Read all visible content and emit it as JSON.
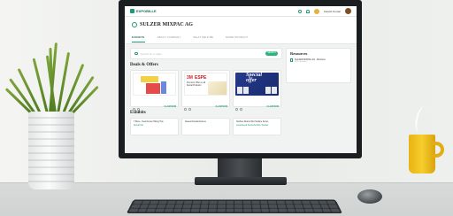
{
  "app": {
    "brand": "EXPOBILLE",
    "user_name": "Suresh Kumar"
  },
  "company": {
    "name": "SULZER MIXPAC AG"
  },
  "tabs": [
    {
      "label": "EXHIBITS",
      "active": true
    },
    {
      "label": "ABOUT COMPANY",
      "active": false
    },
    {
      "label": "WHAT WE'D BE",
      "active": false
    },
    {
      "label": "MORE PRODUCT",
      "active": false
    }
  ],
  "search": {
    "placeholder": "Search for a video",
    "button_label": "SEARCH"
  },
  "deals": {
    "title": "Deals & Offers",
    "items": [
      {
        "cta": "CLAIM NOW"
      },
      {
        "cta": "CLAIM NOW",
        "brand_a": "3M",
        "brand_b": "ESPE",
        "text": "Premium Offer on all Dental Products"
      },
      {
        "cta": "CLAIM NOW",
        "headline_1": "Special",
        "headline_2": "offer"
      }
    ]
  },
  "exhibits": {
    "title": "Exhibits",
    "items": [
      {
        "title": "T Bone - New Device Hiking Tips",
        "sub": "Dental Kits"
      },
      {
        "title": "Newest Dental Devices",
        "sub": ""
      },
      {
        "title": "Sulzbeu Dramol Dot Surface Series",
        "sub": "Guaranteed Dental Surface Studies"
      }
    ]
  },
  "resources": {
    "title": "Resources",
    "items": [
      {
        "name": "SULZER MIXPAC AG - Brochure",
        "meta": "PDF Document"
      }
    ]
  },
  "colors": {
    "accent": "#1d9b78",
    "mug": "#f2c22a",
    "screen_bg": "#f1f3f2"
  }
}
